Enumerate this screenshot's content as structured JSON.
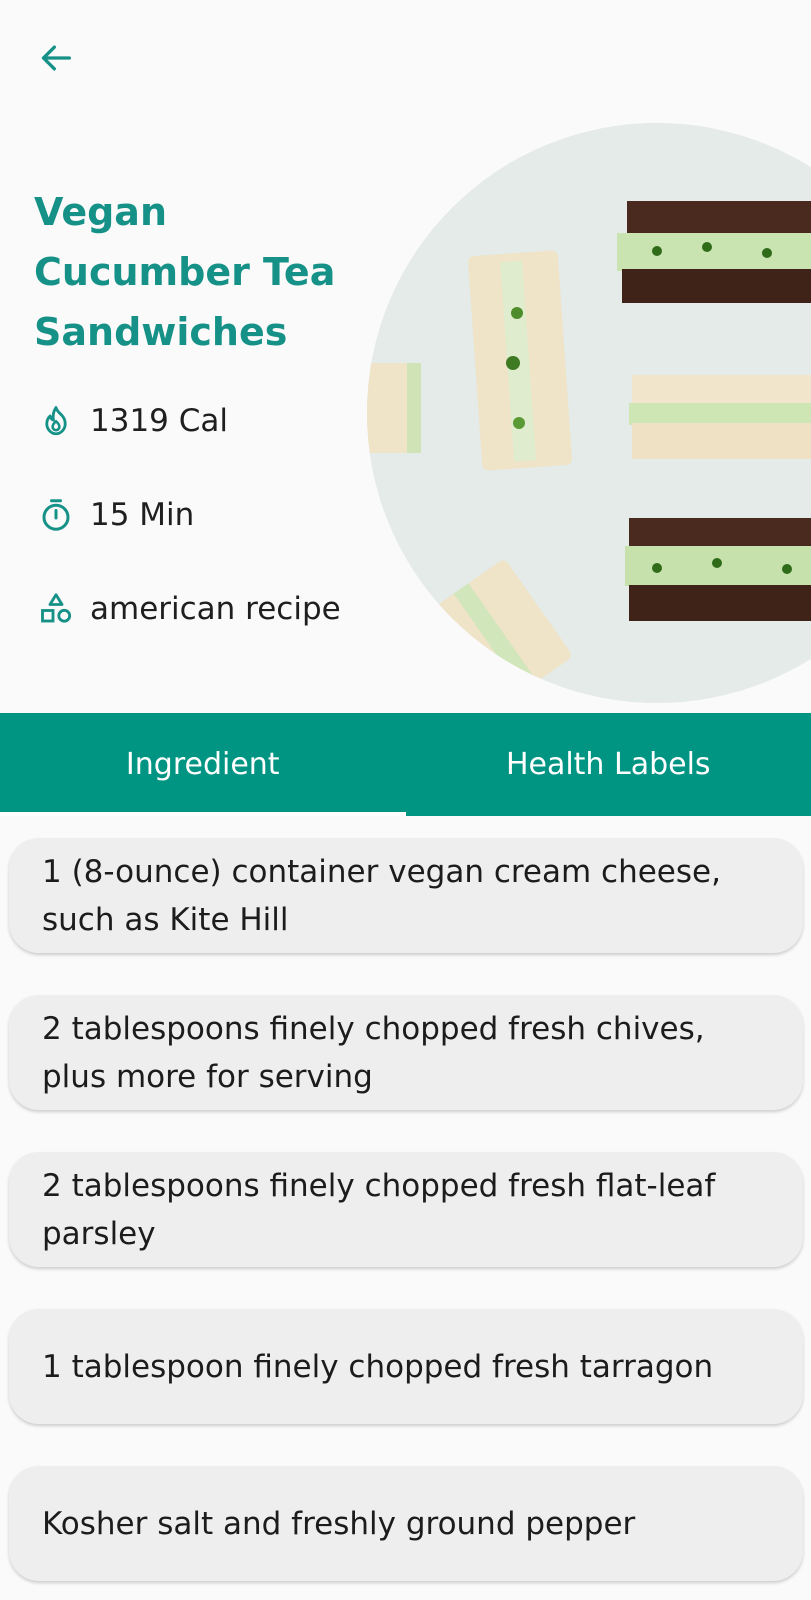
{
  "header": {
    "back_icon": "arrow-left-icon"
  },
  "recipe": {
    "title": "Vegan Cucumber Tea Sandwiches",
    "calories": "1319 Cal",
    "time": "15 Min",
    "cuisine": "american recipe",
    "image_alt": "cucumber tea sandwiches photo"
  },
  "icons": {
    "calories": "flame-icon",
    "time": "timer-icon",
    "cuisine": "category-shapes-icon"
  },
  "tabs": [
    {
      "label": "Ingredient",
      "selected": true
    },
    {
      "label": "Health Labels",
      "selected": false
    }
  ],
  "ingredients": [
    "1 (8-ounce) container vegan cream cheese, such as Kite Hill",
    "2 tablespoons finely chopped fresh chives, plus more for serving",
    "2 tablespoons finely chopped fresh flat-leaf parsley",
    "1 tablespoon finely chopped fresh tarragon",
    "Kosher salt and freshly ground pepper"
  ],
  "colors": {
    "accent": "#169187",
    "tab_bar": "#009483",
    "card": "#eeeeee",
    "background": "#fafafa"
  }
}
